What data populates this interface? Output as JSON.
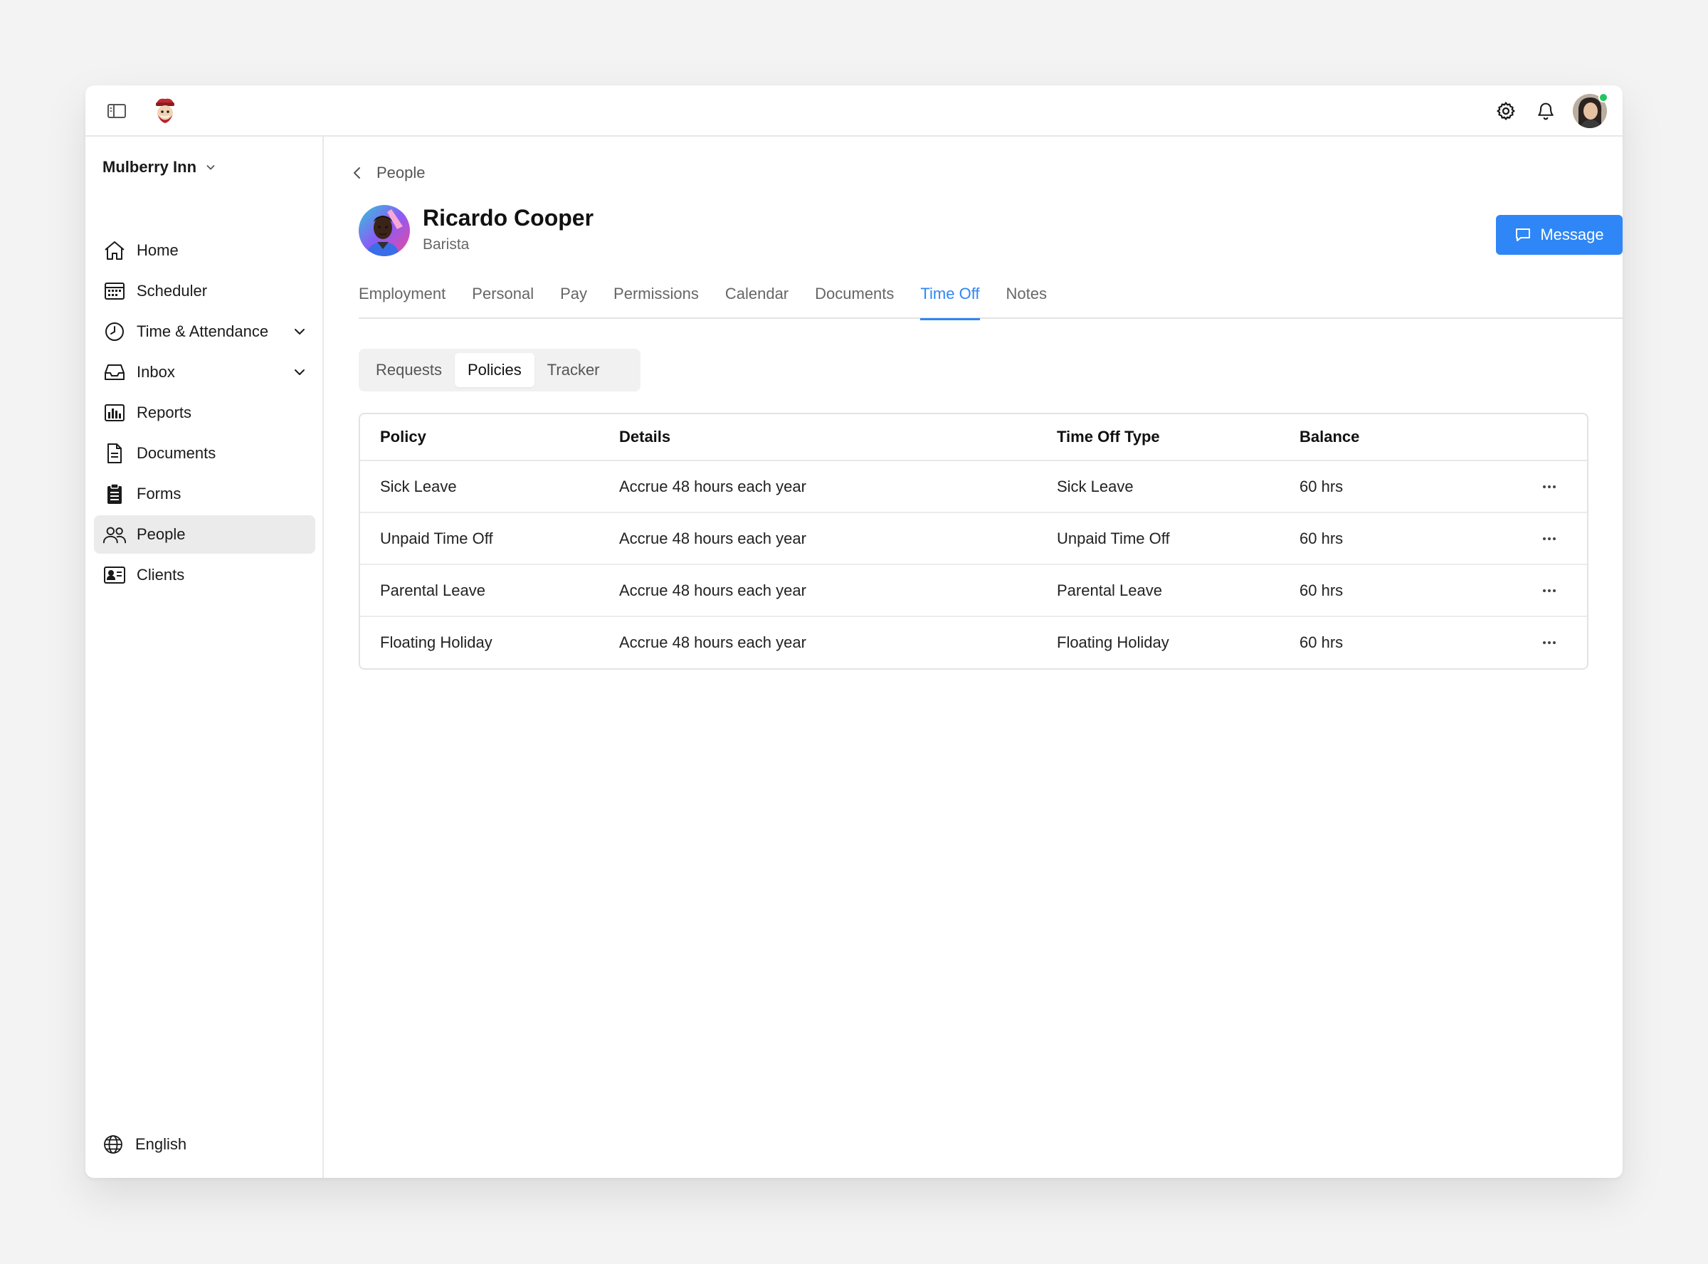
{
  "org": {
    "name": "Mulberry Inn"
  },
  "sidebar": {
    "items": [
      {
        "label": "Home",
        "icon": "home-icon"
      },
      {
        "label": "Scheduler",
        "icon": "calendar-grid-icon"
      },
      {
        "label": "Time & Attendance",
        "icon": "clock-icon",
        "expandable": true
      },
      {
        "label": "Inbox",
        "icon": "inbox-icon",
        "expandable": true
      },
      {
        "label": "Reports",
        "icon": "bar-chart-icon"
      },
      {
        "label": "Documents",
        "icon": "document-icon"
      },
      {
        "label": "Forms",
        "icon": "clipboard-icon"
      },
      {
        "label": "People",
        "icon": "people-icon",
        "active": true
      },
      {
        "label": "Clients",
        "icon": "id-card-icon"
      }
    ],
    "language": "English"
  },
  "breadcrumb": {
    "label": "People"
  },
  "profile": {
    "name": "Ricardo Cooper",
    "role": "Barista"
  },
  "actions": {
    "message_label": "Message"
  },
  "tabs": [
    "Employment",
    "Personal",
    "Pay",
    "Permissions",
    "Calendar",
    "Documents",
    "Time Off",
    "Notes"
  ],
  "active_tab": "Time Off",
  "subtabs": [
    "Requests",
    "Policies",
    "Tracker"
  ],
  "active_subtab": "Policies",
  "table": {
    "columns": [
      "Policy",
      "Details",
      "Time Off Type",
      "Balance"
    ],
    "rows": [
      [
        "Sick Leave",
        "Accrue 48 hours each year",
        "Sick Leave",
        "60 hrs"
      ],
      [
        "Unpaid Time Off",
        "Accrue 48 hours each year",
        "Unpaid Time Off",
        "60 hrs"
      ],
      [
        "Parental Leave",
        "Accrue 48 hours each year",
        "Parental Leave",
        "60 hrs"
      ],
      [
        "Floating Holiday",
        "Accrue 48 hours each year",
        "Floating Holiday",
        "60 hrs"
      ]
    ]
  },
  "colors": {
    "accent": "#2f86f6",
    "online": "#22c55e",
    "active_nav_bg": "#ebebeb"
  }
}
